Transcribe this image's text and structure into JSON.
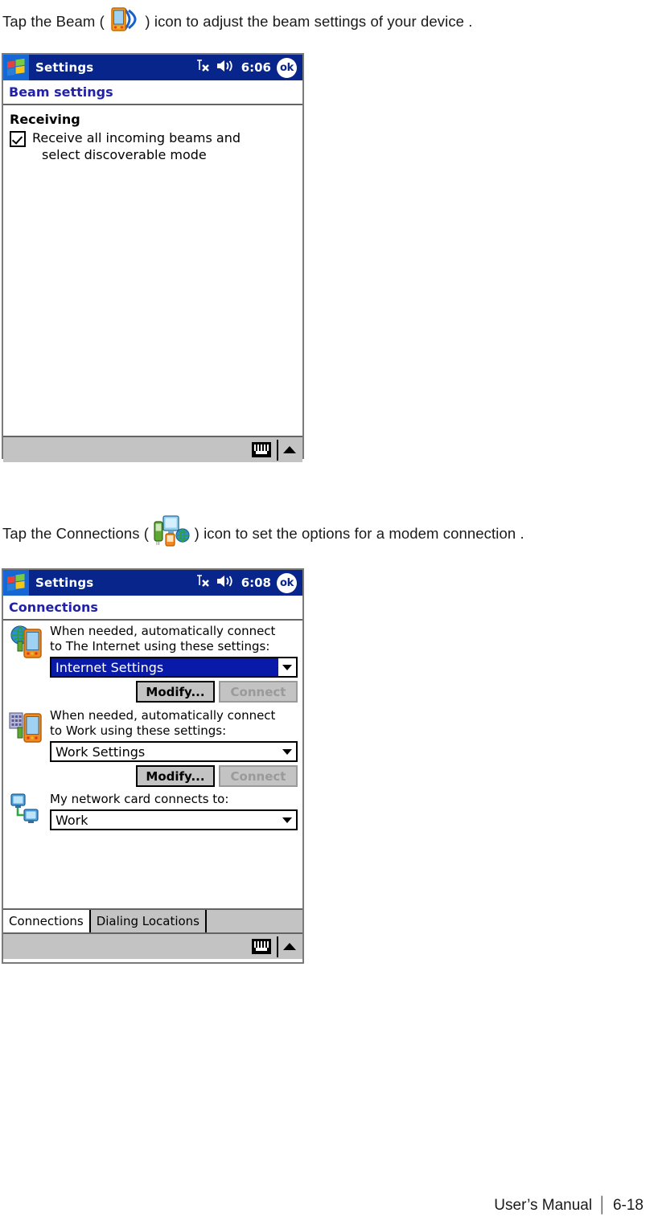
{
  "page": {
    "footer_text": "User’s Manual",
    "footer_separator": "│",
    "footer_page": "6-18"
  },
  "instructions": [
    {
      "id": "beam",
      "before": "Tap the Beam (",
      "icon": "beam-device-icon",
      "after": ") icon to adjust the beam settings of your device ."
    },
    {
      "id": "connections",
      "before": "Tap the Connections (",
      "icon": "connections-devices-icon",
      "after": ") icon to set the options for a modem connection ."
    }
  ],
  "beam_screen": {
    "titlebar": {
      "logo": "windows-flag-icon",
      "title": "Settings",
      "signal_icon": "antenna-no-signal-icon",
      "volume_icon": "speaker-icon",
      "time": "6:06",
      "ok_label": "ok"
    },
    "subheader": "Beam settings",
    "section_label": "Receiving",
    "checkbox": {
      "checked": true,
      "label_line1": "Receive all incoming beams and",
      "label_line2": "select discoverable mode"
    },
    "softbar": {
      "keyboard_icon": "soft-keyboard-icon",
      "arrow_icon": "chevron-up-icon"
    }
  },
  "connections_screen": {
    "titlebar": {
      "logo": "windows-flag-icon",
      "title": "Settings",
      "signal_icon": "antenna-no-signal-icon",
      "volume_icon": "speaker-icon",
      "time": "6:08",
      "ok_label": "ok"
    },
    "subheader": "Connections",
    "rows": [
      {
        "icon": "globe-pda-icon",
        "text_line1": "When needed, automatically connect",
        "text_line2": "to The Internet using these settings:",
        "combo_value": "Internet Settings",
        "combo_selected": true,
        "modify_label": "Modify...",
        "connect_label": "Connect",
        "connect_enabled": false
      },
      {
        "icon": "office-pda-icon",
        "text_line1": "When needed, automatically connect",
        "text_line2": "to Work using these settings:",
        "combo_value": "Work Settings",
        "combo_selected": false,
        "modify_label": "Modify...",
        "connect_label": "Connect",
        "connect_enabled": false
      },
      {
        "icon": "network-card-icon",
        "text_line1": "My network card connects to:",
        "text_line2": "",
        "combo_value": "Work",
        "combo_selected": false
      }
    ],
    "tabs": [
      {
        "label": "Connections",
        "active": true
      },
      {
        "label": "Dialing Locations",
        "active": false
      }
    ],
    "softbar": {
      "keyboard_icon": "soft-keyboard-icon",
      "arrow_icon": "chevron-up-icon"
    }
  }
}
